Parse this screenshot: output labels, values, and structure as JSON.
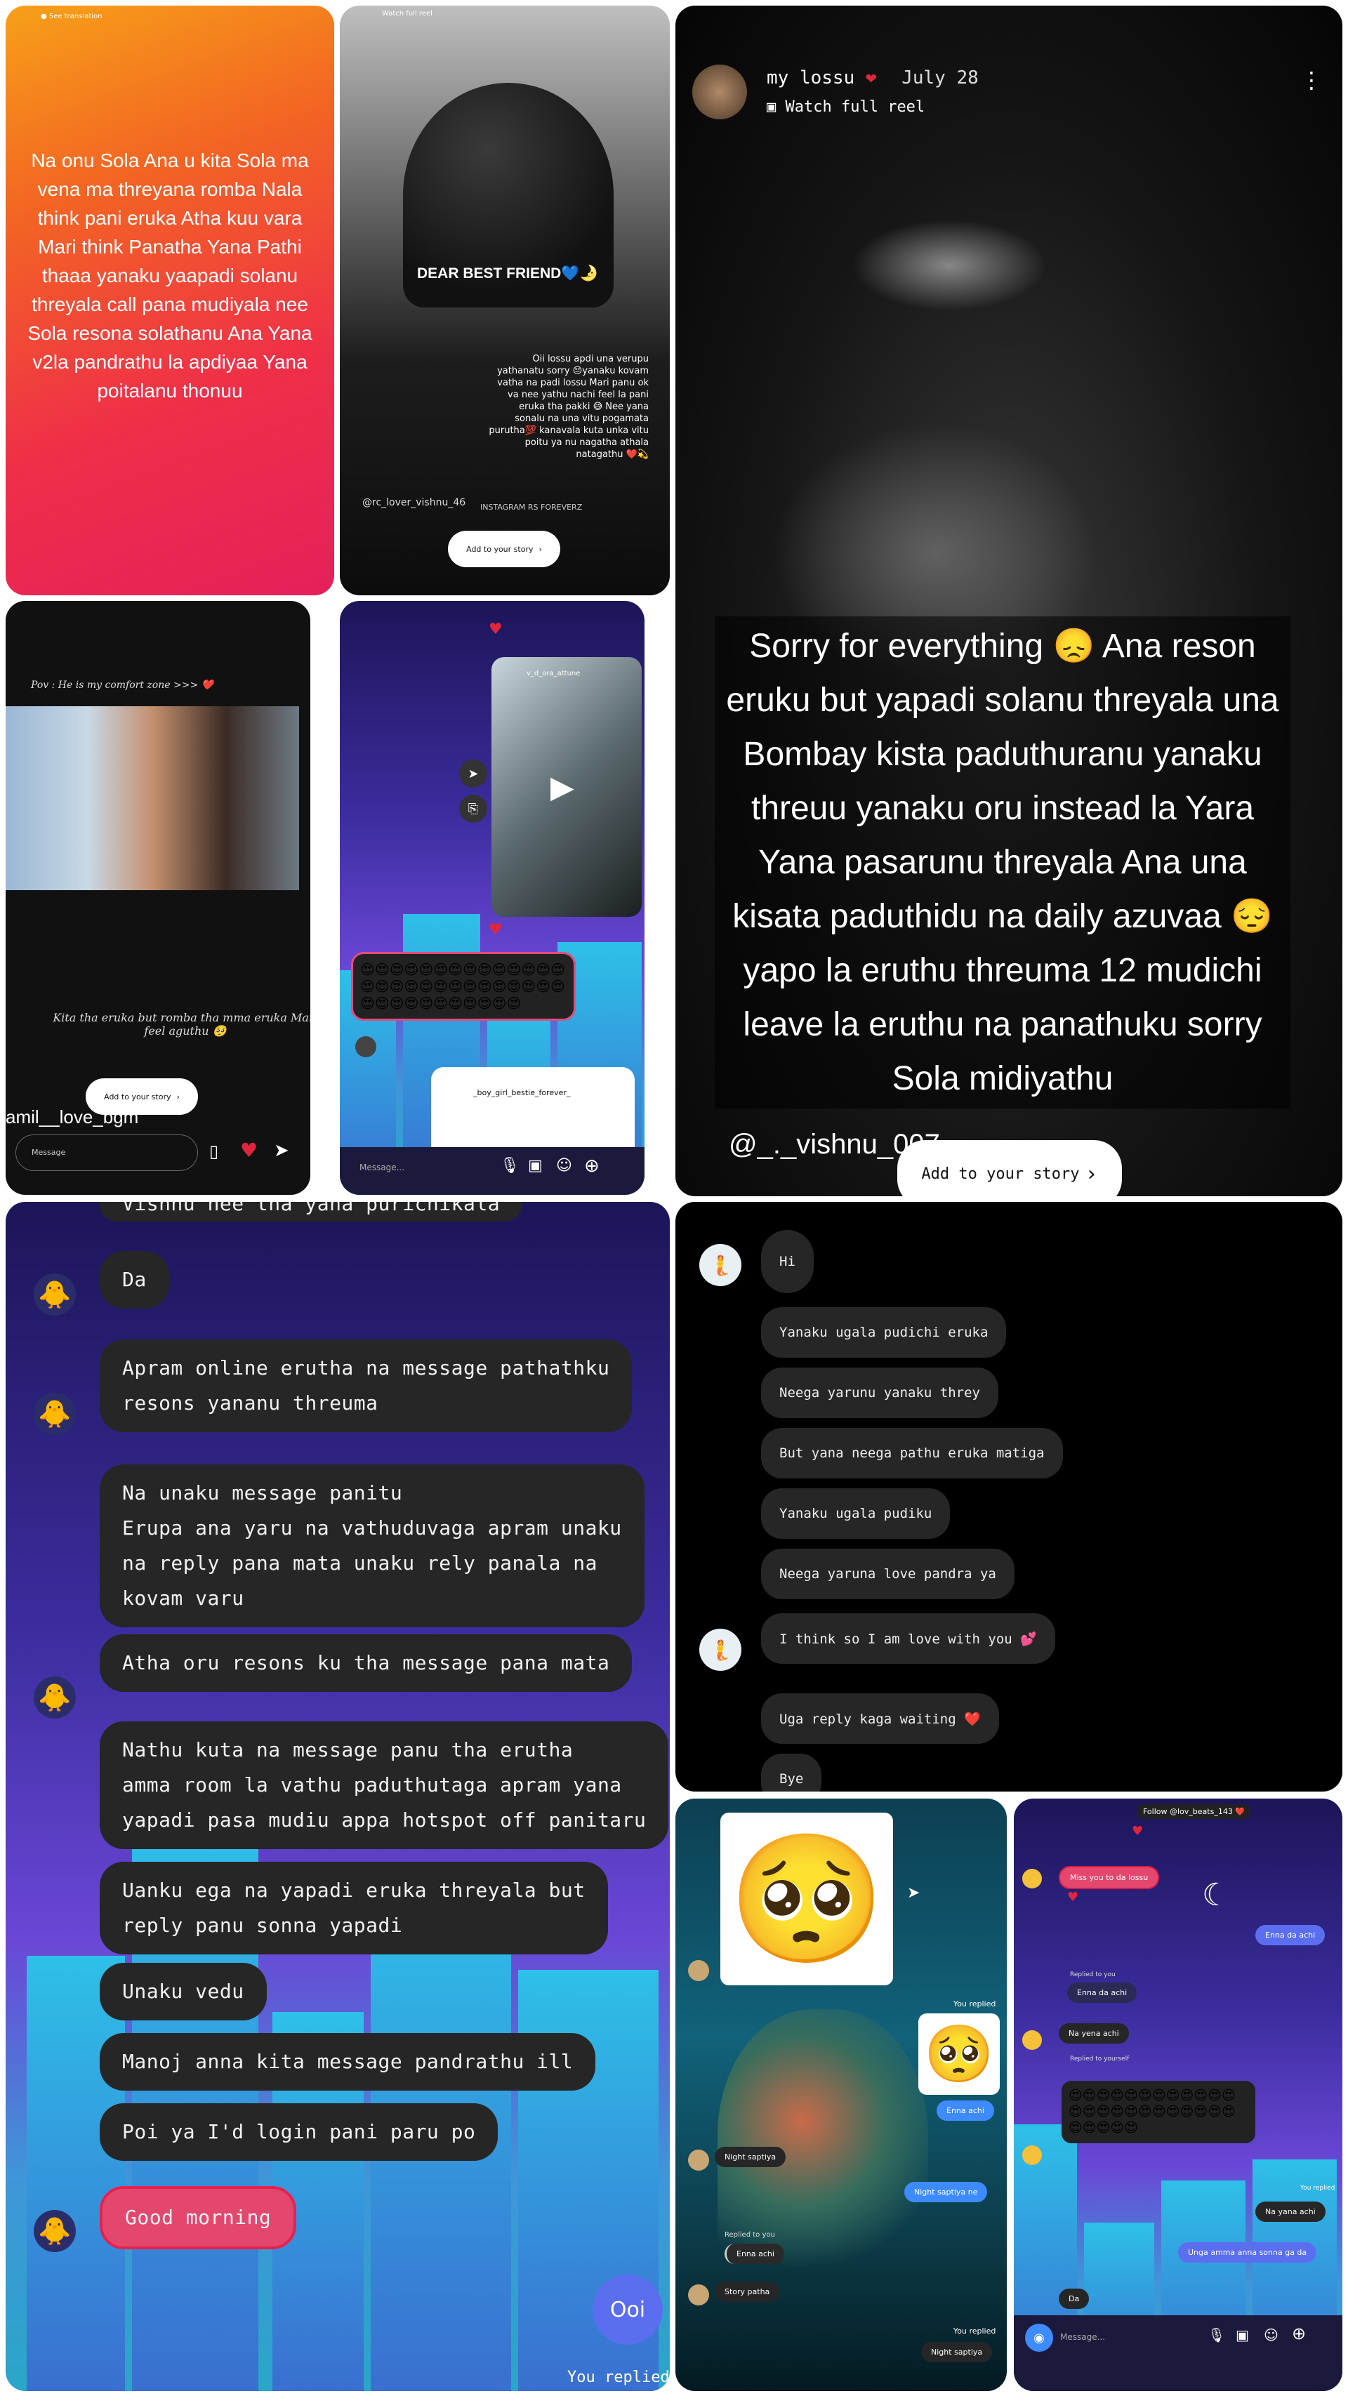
{
  "p1": {
    "top": "See translation",
    "text": "Na onu Sola Ana u kita Sola ma vena ma threyana romba Nala think pani eruka Atha kuu vara Mari think Panatha Yana Pathi thaaa yanaku yaapadi solanu threyala call pana mudiyala nee Sola resona solathanu Ana Yana v2la pandrathu la apdiyaa Yana poitalanu thonuu"
  },
  "p2": {
    "top": "Watch full reel",
    "title": "DEAR BEST FRIEND💙🌛",
    "body": "Oii lossu apdi una verupu yathanatu sorry 😔yanaku kovam vatha na padi lossu Mari panu ok va nee yathu nachi feel la pani eruka tha pakki 😅 Nee yana sonalu na una vitu pogamata purutha💯 kanavala kuta unka vitu poitu ya nu nagatha athala natagathu ❤️💫",
    "user": "@rc_lover_vishnu_46",
    "brand": "INSTAGRAM RS FOREVERZ",
    "story": "Add to your story"
  },
  "p3": {
    "user": "my lossu",
    "date": "July 28",
    "watch": "Watch full reel",
    "text": "Sorry for everything 😞 Ana reson eruku but yapadi solanu threyala una Bombay kista paduthuranu yanaku threuu yanaku oru instead la Yara Yana pasarunu threyala Ana una kisata paduthidu na daily azuvaa 😔 yapo la eruthu threuma 12 mudichi leave la eruthu na panathuku sorry Sola midiyathu",
    "handle": "@_._vishnu_007",
    "story": "Add to your story"
  },
  "p4": {
    "pov": "Pov : He is my comfort zone >>> ❤️",
    "caption": "Kita tha eruka but romba tha mma eruka Mari feel aguthu 🥺",
    "user": "amil__love_bgm",
    "story": "Add to your story",
    "msg": "Message"
  },
  "p5": {
    "user1": "v_d_ora_attune",
    "user2": "_boy_girl_bestie_forever_",
    "emoji": "😍😍😍😍😍😍😍😍😍😍😍😍😍😍😍😍😍😍😍😍😍😍😍😍😍😍😍😍😍😍😍😍😍😍😍😍😍😍😍",
    "msg": "Message..."
  },
  "p6": {
    "msgs": [
      "Vishnu nee tha yana purichikala",
      "Da",
      "Apram online erutha na message pathathku\nresons yananu threuma",
      "Na unaku message panitu\nErupa ana yaru na vathuduvaga apram unaku\nna reply pana mata unaku rely panala na\nkovam varu",
      "Atha oru resons ku tha message pana mata",
      "Nathu kuta na message panu tha erutha\namma room la vathu paduthutaga apram yana\nyapadi pasa mudiu appa hotspot off panitaru",
      "Uanku ega na yapadi eruka threyala but\nreply panu sonna yapadi",
      "Unaku vedu",
      "Manoj anna kita message pandrathu ill",
      "Poi ya I'd login pani paru  po",
      "Good morning",
      "Ooi",
      "You replied"
    ]
  },
  "p7": {
    "msgs": [
      "Hi",
      "Yanaku ugala pudichi eruka",
      "Neega yarunu yanaku threy",
      "But yana neega pathu eruka matiga",
      "Yanaku ugala pudiku",
      "Neega yaruna love pandra ya",
      "I think so I am love with you 💕",
      "Uga reply kaga waiting ❤️",
      "Bye"
    ]
  },
  "p8": {
    "youreplied": "You replied",
    "enna": "Enna achi",
    "night": "Night saptiya",
    "night2": "Night saptiya ne",
    "repl": "Replied to you",
    "story": "Story patha",
    "last": "Night saptiya"
  },
  "p9": {
    "top": "Follow @lov_beats_143 ❤️",
    "miss": "Miss you to da lossu",
    "enna": "Enna da achi",
    "r1": "Replied to you",
    "r2": "Enna da achi",
    "nayena": "Na yena achi",
    "r3": "Replied to yourself",
    "emoji": "😍😍😍😍😍😍😍😍😍😍😍😍😍😍😍😍😍😍😍😍😍😍😍😍😍😍😍😍😍",
    "yr": "You replied",
    "nayana": "Na yana achi",
    "unga": "Unga amma anna sonna ga da",
    "da": "Da",
    "msg": "Message..."
  }
}
